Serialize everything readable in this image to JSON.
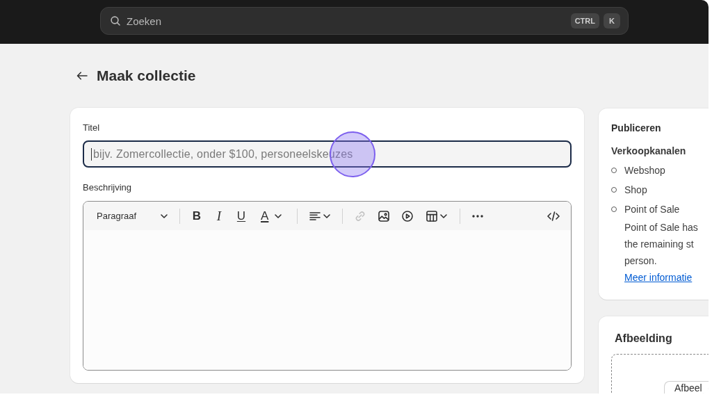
{
  "top_bar": {
    "search": {
      "placeholder": "Zoeken",
      "shortcut_keys": [
        "CTRL",
        "K"
      ]
    }
  },
  "header": {
    "title": "Maak collectie"
  },
  "main_card": {
    "title_field": {
      "label": "Titel",
      "placeholder": "bijv. Zomercollectie, onder $100, personeelskeuzes",
      "focused": true,
      "click_indicator": true
    },
    "description_field": {
      "label": "Beschrijving",
      "format_menu": "Paragraaf",
      "style_buttons": [
        {
          "kind": "bold",
          "label": "B"
        },
        {
          "kind": "italic",
          "label": "I"
        },
        {
          "kind": "underline",
          "label": "U"
        },
        {
          "kind": "text_color",
          "label": "A"
        }
      ],
      "link_button": {
        "disabled": true
      }
    }
  },
  "publish_card": {
    "title": "Publiceren",
    "section": "Verkoopkanalen",
    "channels": [
      {
        "label": "Webshop",
        "published": false
      },
      {
        "label": "Shop",
        "published": false
      },
      {
        "label": "Point of Sale",
        "published": false,
        "note_lines": [
          "Point of Sale has",
          "the remaining st",
          "person."
        ],
        "link": "Meer informatie"
      }
    ]
  },
  "image_card": {
    "title": "Afbeelding",
    "button": "Afbeel"
  }
}
